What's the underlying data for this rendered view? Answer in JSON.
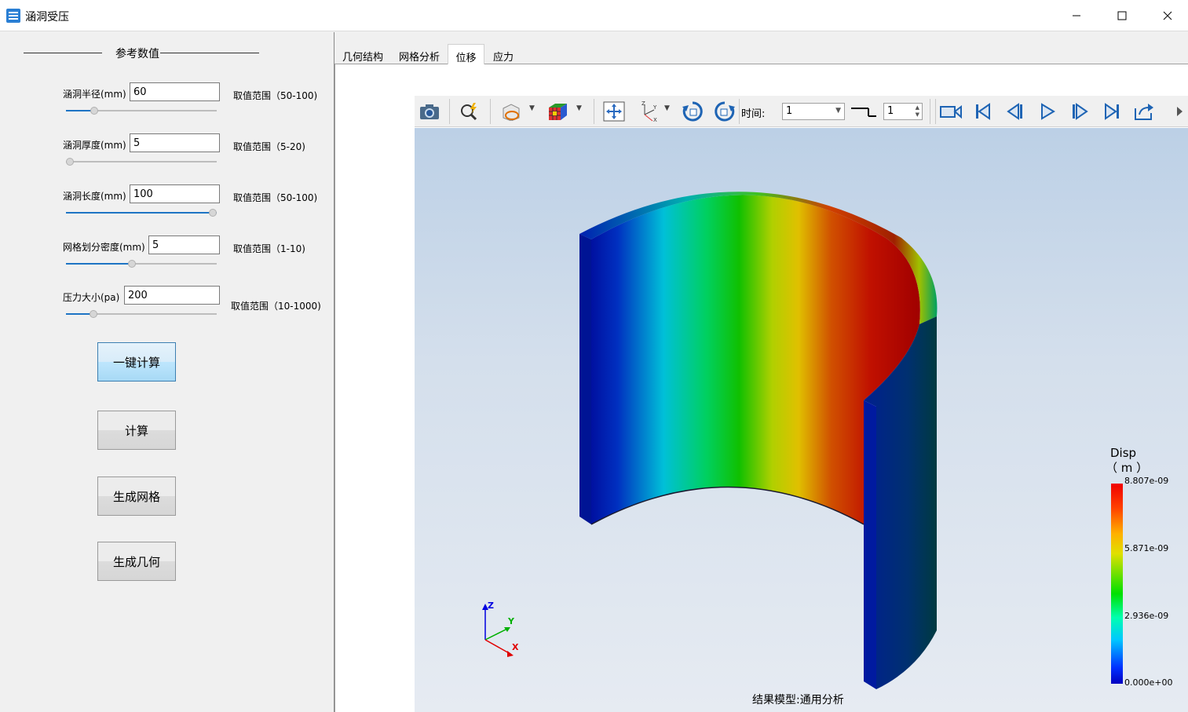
{
  "window": {
    "title": "涵洞受压"
  },
  "params": {
    "group_title": "参考数值",
    "items": [
      {
        "label": "涵洞半径(mm)",
        "value": "60",
        "range": "取值范围（50-100)",
        "slider_fraction": 0.19
      },
      {
        "label": "涵洞厚度(mm)",
        "value": "5",
        "range": "取值范围（5-20)",
        "slider_fraction": 0.0
      },
      {
        "label": "涵洞长度(mm)",
        "value": "100",
        "range": "取值范围（50-100)",
        "slider_fraction": 1.0
      },
      {
        "label": "网格划分密度(mm)",
        "value": "5",
        "range": "取值范围（1-10)",
        "slider_fraction": 0.44
      },
      {
        "label": "压力大小(pa)",
        "value": "200",
        "range": "取值范围（10-1000)",
        "slider_fraction": 0.18
      }
    ]
  },
  "buttons": {
    "one_click": "一键计算",
    "compute": "计算",
    "gen_mesh": "生成网格",
    "gen_geom": "生成几何"
  },
  "tabs": [
    {
      "label": "几何结构",
      "active": false
    },
    {
      "label": "网格分析",
      "active": false
    },
    {
      "label": "位移",
      "active": true
    },
    {
      "label": "应力",
      "active": false
    }
  ],
  "toolbar": {
    "time_label": "时间:",
    "time_value": "1",
    "step_value": "1"
  },
  "legend": {
    "title": "Disp",
    "unit": "（ m ）",
    "ticks": [
      "8.807e-09",
      "5.871e-09",
      "2.936e-09",
      "0.000e+00"
    ]
  },
  "viewport": {
    "status": "结果模型:通用分析",
    "axes": {
      "z": "Z",
      "y": "Y",
      "x": "X"
    }
  },
  "colors": {
    "accent": "#1e74c4",
    "disp_max": "#f00000",
    "disp_min": "#0000c0"
  }
}
